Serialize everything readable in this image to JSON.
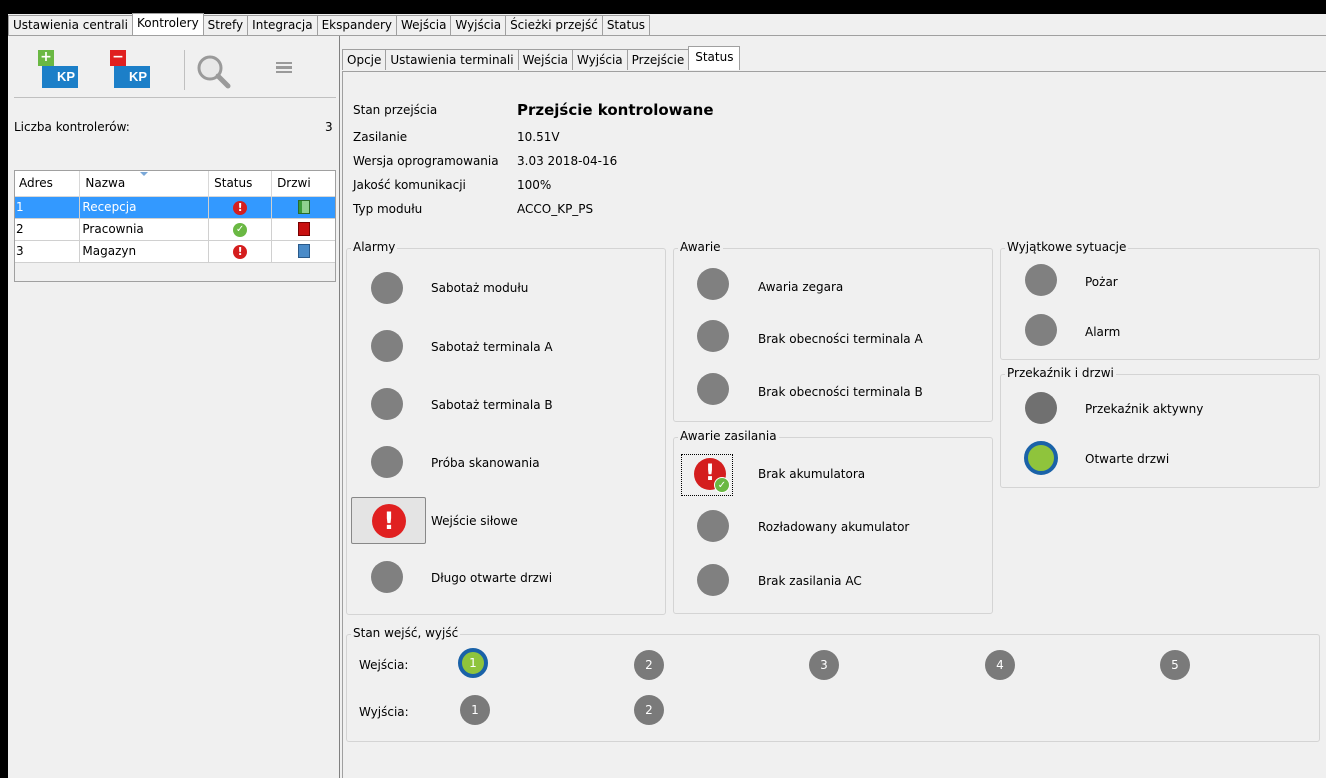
{
  "main_tabs": [
    "Ustawienia centrali",
    "Kontrolery",
    "Strefy",
    "Integracja",
    "Ekspandery",
    "Wejścia",
    "Wyjścia",
    "Ścieżki przejść",
    "Status"
  ],
  "toolbar": {
    "add_label": "KP",
    "remove_label": "KP"
  },
  "controllers": {
    "count_label": "Liczba kontrolerów:",
    "count_value": "3",
    "headers": [
      "Adres",
      "Nazwa",
      "Status",
      "Drzwi"
    ],
    "rows": [
      {
        "addr": "1",
        "name": "Recepcja",
        "status": "error",
        "door": "green"
      },
      {
        "addr": "2",
        "name": "Pracownia",
        "status": "ok",
        "door": "red"
      },
      {
        "addr": "3",
        "name": "Magazyn",
        "status": "error",
        "door": "blue"
      }
    ]
  },
  "sub_tabs": [
    "Opcje",
    "Ustawienia terminali",
    "Wejścia",
    "Wyjścia",
    "Przejście",
    "Status"
  ],
  "info": {
    "state_label": "Stan przejścia",
    "state_value": "Przejście kontrolowane",
    "power_label": "Zasilanie",
    "power_value": "10.51V",
    "fw_label": "Wersja oprogramowania",
    "fw_value": "3.03 2018-04-16",
    "comm_label": "Jakość komunikacji",
    "comm_value": "100%",
    "type_label": "Typ modułu",
    "type_value": "ACCO_KP_PS"
  },
  "alarms": {
    "title": "Alarmy",
    "items": [
      "Sabotaż modułu",
      "Sabotaż terminala A",
      "Sabotaż terminala B",
      "Próba skanowania",
      "Wejście siłowe",
      "Długo otwarte drzwi"
    ]
  },
  "faults": {
    "title": "Awarie",
    "items": [
      "Awaria zegara",
      "Brak obecności terminala A",
      "Brak obecności terminala B"
    ]
  },
  "power_faults": {
    "title": "Awarie zasilania",
    "items": [
      "Brak akumulatora",
      "Rozładowany akumulator",
      "Brak zasilania AC"
    ]
  },
  "special": {
    "title": "Wyjątkowe sytuacje",
    "items": [
      "Pożar",
      "Alarm"
    ]
  },
  "relay": {
    "title": "Przekaźnik i drzwi",
    "items": [
      "Przekaźnik aktywny",
      "Otwarte drzwi"
    ]
  },
  "io": {
    "title": "Stan wejść, wyjść",
    "inputs_label": "Wejścia:",
    "outputs_label": "Wyjścia:",
    "inputs": [
      "1",
      "2",
      "3",
      "4",
      "5"
    ],
    "outputs": [
      "1",
      "2"
    ]
  },
  "colors": {
    "selection": "#3399ff",
    "led_off": "#808080",
    "led_on": "#8fc43c",
    "led_ring": "#1a62a8",
    "alarm_red": "#d41e1e"
  }
}
